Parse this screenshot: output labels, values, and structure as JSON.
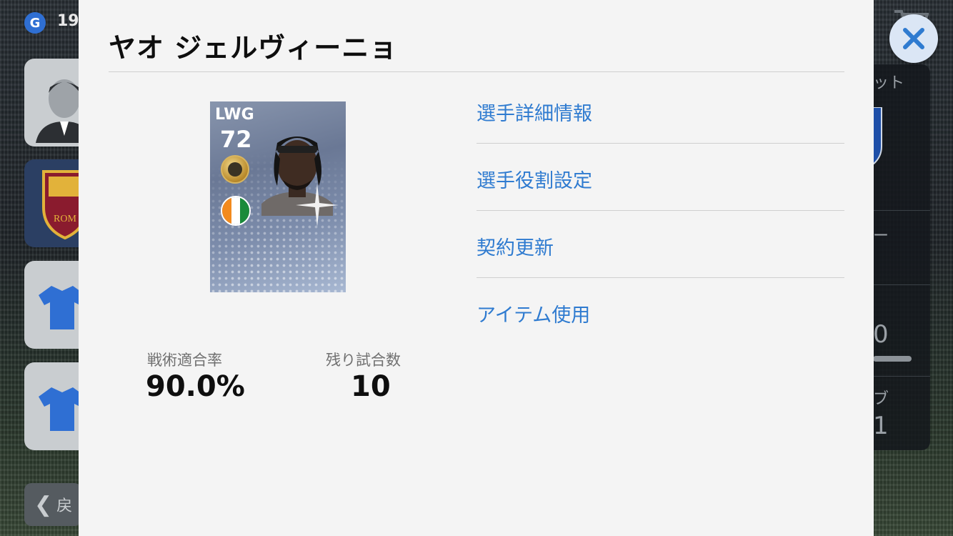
{
  "background": {
    "coin_badge": "G",
    "coin_value": "19",
    "back_label": "戻",
    "right_panel_texts": [
      "ット",
      "ー",
      "0",
      "ブ",
      "1"
    ]
  },
  "dialog": {
    "title": "ヤオ ジェルヴィーニョ",
    "card": {
      "position": "LWG",
      "rating": "72",
      "medal_color": "#c9a03f",
      "flag_colors": [
        "#f28a1e",
        "#ffffff",
        "#1a8a3a"
      ]
    },
    "stats": [
      {
        "label": "戦術適合率",
        "value": "90.0%"
      },
      {
        "label": "残り試合数",
        "value": "10"
      }
    ],
    "menu": [
      {
        "label": "選手詳細情報"
      },
      {
        "label": "選手役割設定"
      },
      {
        "label": "契約更新"
      },
      {
        "label": "アイテム使用"
      }
    ]
  },
  "colors": {
    "link": "#2f7bd0",
    "dialog_bg": "#f4f4f4",
    "close_icon": "#2f7bd0"
  },
  "icons": [
    "close-icon",
    "shirt-icon",
    "chevron-left-icon",
    "cart-icon",
    "manager-avatar-icon",
    "club-crest-icon"
  ]
}
